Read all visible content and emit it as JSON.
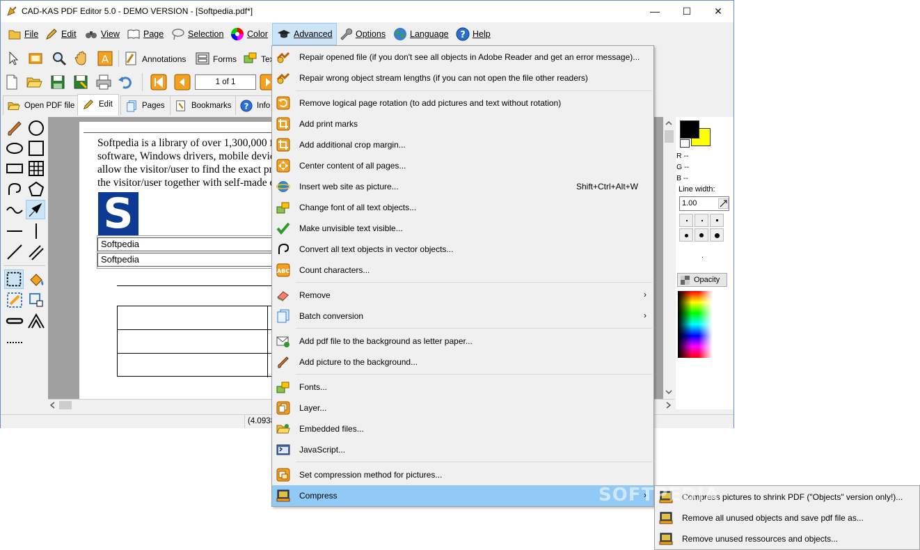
{
  "window": {
    "title": "CAD-KAS PDF Editor 5.0 - DEMO VERSION - [Softpedia.pdf*]"
  },
  "title_controls": {
    "minimize": "—",
    "maximize": "☐",
    "close": "✕"
  },
  "menubar": {
    "items": [
      {
        "label": "File",
        "icon": "folder-icon"
      },
      {
        "label": "Edit",
        "icon": "pencil-icon"
      },
      {
        "label": "View",
        "icon": "binoculars-icon"
      },
      {
        "label": "Page",
        "icon": "book-icon"
      },
      {
        "label": "Selection",
        "icon": "lasso-icon"
      },
      {
        "label": "Color",
        "icon": "color-wheel-icon"
      },
      {
        "label": "Advanced",
        "icon": "graduation-cap-icon"
      },
      {
        "label": "Options",
        "icon": "wrench-icon"
      },
      {
        "label": "Language",
        "icon": "globe-icon"
      },
      {
        "label": "Help",
        "icon": "help-icon"
      }
    ]
  },
  "toolbar1": {
    "annotations": "Annotations",
    "forms": "Forms",
    "text": "Tex"
  },
  "toolbar2": {
    "page_indicator": "1 of 1"
  },
  "tabs": [
    {
      "label": "Open PDF file"
    },
    {
      "label": "Edit"
    },
    {
      "label": "Pages"
    },
    {
      "label": "Bookmarks"
    },
    {
      "label": "Info"
    }
  ],
  "document": {
    "lines": [
      "Softpedia is a library of over 1,300,000 fr",
      "software, Windows drivers, mobile devic",
      "allow the visitor/user to find the exact pro",
      "the visitor/user together with self-made ev"
    ],
    "logo_letter": "S",
    "fields": [
      "Softpedia",
      "Softpedia"
    ]
  },
  "statusbar": {
    "coords": "(4.0938"
  },
  "right_panel": {
    "primary_color": "#000000",
    "secondary_color": "#ffff00",
    "r_label": "R --",
    "g_label": "G --",
    "b_label": "B --",
    "line_width_label": "Line width:",
    "line_width_value": "1.00",
    "opacity_label": "Opacity"
  },
  "advanced_menu": {
    "items": [
      {
        "label": "Repair opened file (if you don't see all objects in Adobe Reader and get an error message)...",
        "icon": "repair-icon"
      },
      {
        "label": "Repair wrong object stream lengths (if you can not open the file other readers)",
        "icon": "repair-icon"
      },
      {
        "label": "Remove logical page rotation (to add pictures and text without rotation)",
        "icon": "rotate-icon"
      },
      {
        "label": "Add print marks",
        "icon": "crop-icon"
      },
      {
        "label": "Add additional crop margin...",
        "icon": "crop-icon"
      },
      {
        "label": "Center content of all pages...",
        "icon": "center-icon"
      },
      {
        "label": "Insert web site as picture...",
        "icon": "web-icon",
        "shortcut": "Shift+Ctrl+Alt+W"
      },
      {
        "label": "Change font of all text objects...",
        "icon": "font-icon"
      },
      {
        "label": "Make unvisible text visible...",
        "icon": "checkmark-icon"
      },
      {
        "label": "Convert all text objects in vector objects...",
        "icon": "vector-icon"
      },
      {
        "label": "Count characters...",
        "icon": "abc-icon"
      },
      {
        "label": "Remove",
        "icon": "eraser-icon",
        "submenu": true
      },
      {
        "label": "Batch conversion",
        "icon": "documents-icon",
        "submenu": true
      },
      {
        "label": "Add pdf file to the background as letter paper...",
        "icon": "envelope-icon"
      },
      {
        "label": "Add picture to the background...",
        "icon": "brush-icon"
      },
      {
        "label": "Fonts...",
        "icon": "fonts-icon"
      },
      {
        "label": "Layer...",
        "icon": "layer-icon"
      },
      {
        "label": "Embedded files...",
        "icon": "folder-attach-icon"
      },
      {
        "label": "JavaScript...",
        "icon": "javascript-icon"
      },
      {
        "label": "Set compression method for pictures...",
        "icon": "compress-settings-icon"
      },
      {
        "label": "Compress",
        "icon": "compress-icon",
        "submenu": true
      }
    ],
    "submenu_arrow": "›"
  },
  "compress_submenu": {
    "items": [
      {
        "label": "Compress pictures to shrink PDF (\"Objects\" version only!)...",
        "icon": "compress-icon"
      },
      {
        "label": "Remove all unused objects and save pdf file as...",
        "icon": "compress-icon"
      },
      {
        "label": "Remove unused ressources and objects...",
        "icon": "compress-icon"
      }
    ]
  },
  "watermark": "SOFTPEDIA"
}
